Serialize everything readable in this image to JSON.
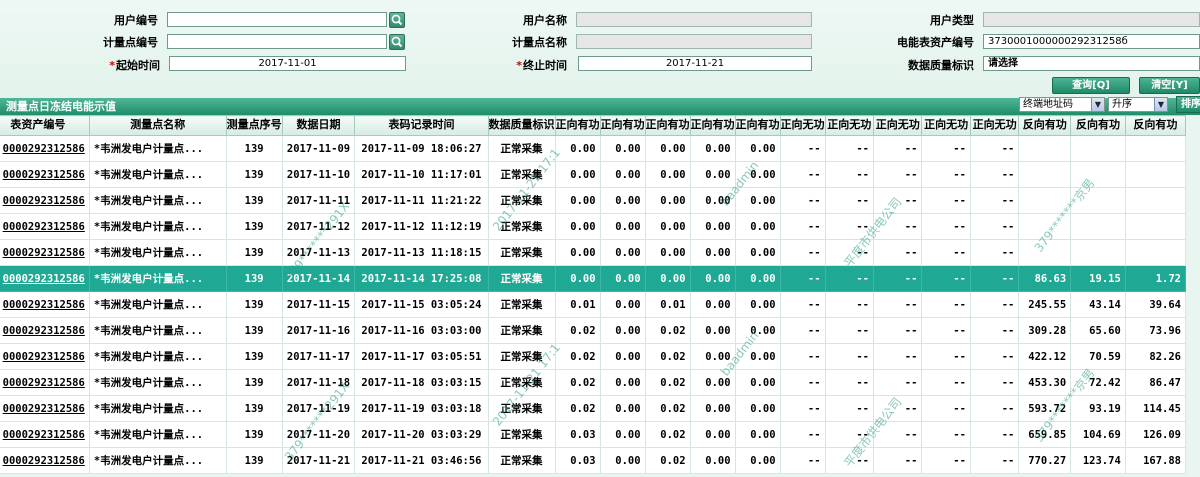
{
  "form": {
    "user_no_label": "用户编号",
    "user_no_value": "",
    "user_name_label": "用户名称",
    "user_name_value": "",
    "user_type_label": "用户类型",
    "user_type_value": "",
    "mp_no_label": "计量点编号",
    "mp_no_value": "",
    "mp_name_label": "计量点名称",
    "mp_name_value": "",
    "meter_asset_label": "电能表资产编号",
    "meter_asset_value": "373000100000029231258б",
    "start_time_label": "起始时间",
    "start_time_value": "2017-11-01",
    "end_time_label": "终止时间",
    "end_time_value": "2017-11-21",
    "quality_label": "数据质量标识",
    "quality_value": "请选择",
    "required_mark": "*",
    "query_button": "查询[Q]",
    "clear_button": "清空[Y]"
  },
  "panel": {
    "title": "测量点日冻结电能示值",
    "sort_field": "终端地址码",
    "sort_order": "升序",
    "sort_button": "排序"
  },
  "grid": {
    "headers": [
      "表资产编号",
      "测量点名称",
      "测量点序号",
      "数据日期",
      "表码记录时间",
      "数据质量标识",
      "正向有功",
      "正向有功",
      "正向有功",
      "正向有功",
      "正向有功",
      "正向无功",
      "正向无功",
      "正向无功",
      "正向无功",
      "正向无功",
      "反向有功",
      "反向有功",
      "反向有功"
    ],
    "rows": [
      [
        "0000292312586",
        "*韦洲发电户计量点...",
        "139",
        "2017-11-09",
        "2017-11-09 18:06:27",
        "正常采集",
        "0.00",
        "0.00",
        "0.00",
        "0.00",
        "0.00",
        "--",
        "--",
        "--",
        "--",
        "--",
        "",
        "",
        ""
      ],
      [
        "0000292312586",
        "*韦洲发电户计量点...",
        "139",
        "2017-11-10",
        "2017-11-10 11:17:01",
        "正常采集",
        "0.00",
        "0.00",
        "0.00",
        "0.00",
        "0.00",
        "--",
        "--",
        "--",
        "--",
        "--",
        "",
        "",
        ""
      ],
      [
        "0000292312586",
        "*韦洲发电户计量点...",
        "139",
        "2017-11-11",
        "2017-11-11 11:21:22",
        "正常采集",
        "0.00",
        "0.00",
        "0.00",
        "0.00",
        "0.00",
        "--",
        "--",
        "--",
        "--",
        "--",
        "",
        "",
        ""
      ],
      [
        "0000292312586",
        "*韦洲发电户计量点...",
        "139",
        "2017-11-12",
        "2017-11-12 11:12:19",
        "正常采集",
        "0.00",
        "0.00",
        "0.00",
        "0.00",
        "0.00",
        "--",
        "--",
        "--",
        "--",
        "--",
        "",
        "",
        ""
      ],
      [
        "0000292312586",
        "*韦洲发电户计量点...",
        "139",
        "2017-11-13",
        "2017-11-13 11:18:15",
        "正常采集",
        "0.00",
        "0.00",
        "0.00",
        "0.00",
        "0.00",
        "--",
        "--",
        "--",
        "--",
        "--",
        "",
        "",
        ""
      ],
      [
        "0000292312586",
        "*韦洲发电户计量点...",
        "139",
        "2017-11-14",
        "2017-11-14 17:25:08",
        "正常采集",
        "0.00",
        "0.00",
        "0.00",
        "0.00",
        "0.00",
        "--",
        "--",
        "--",
        "--",
        "--",
        "86.63",
        "19.15",
        "1.72"
      ],
      [
        "0000292312586",
        "*韦洲发电户计量点...",
        "139",
        "2017-11-15",
        "2017-11-15 03:05:24",
        "正常采集",
        "0.01",
        "0.00",
        "0.01",
        "0.00",
        "0.00",
        "--",
        "--",
        "--",
        "--",
        "--",
        "245.55",
        "43.14",
        "39.64"
      ],
      [
        "0000292312586",
        "*韦洲发电户计量点...",
        "139",
        "2017-11-16",
        "2017-11-16 03:03:00",
        "正常采集",
        "0.02",
        "0.00",
        "0.02",
        "0.00",
        "0.00",
        "--",
        "--",
        "--",
        "--",
        "--",
        "309.28",
        "65.60",
        "73.96"
      ],
      [
        "0000292312586",
        "*韦洲发电户计量点...",
        "139",
        "2017-11-17",
        "2017-11-17 03:05:51",
        "正常采集",
        "0.02",
        "0.00",
        "0.02",
        "0.00",
        "0.00",
        "--",
        "--",
        "--",
        "--",
        "--",
        "422.12",
        "70.59",
        "82.26"
      ],
      [
        "0000292312586",
        "*韦洲发电户计量点...",
        "139",
        "2017-11-18",
        "2017-11-18 03:03:15",
        "正常采集",
        "0.02",
        "0.00",
        "0.02",
        "0.00",
        "0.00",
        "--",
        "--",
        "--",
        "--",
        "--",
        "453.30",
        "72.42",
        "86.47"
      ],
      [
        "0000292312586",
        "*韦洲发电户计量点...",
        "139",
        "2017-11-19",
        "2017-11-19 03:03:18",
        "正常采集",
        "0.02",
        "0.00",
        "0.02",
        "0.00",
        "0.00",
        "--",
        "--",
        "--",
        "--",
        "--",
        "593.72",
        "93.19",
        "114.45"
      ],
      [
        "0000292312586",
        "*韦洲发电户计量点...",
        "139",
        "2017-11-20",
        "2017-11-20 03:03:29",
        "正常采集",
        "0.03",
        "0.00",
        "0.02",
        "0.00",
        "0.00",
        "--",
        "--",
        "--",
        "--",
        "--",
        "659.85",
        "104.69",
        "126.09"
      ],
      [
        "0000292312586",
        "*韦洲发电户计量点...",
        "139",
        "2017-11-21",
        "2017-11-21 03:46:56",
        "正常采集",
        "0.03",
        "0.00",
        "0.02",
        "0.00",
        "0.00",
        "--",
        "--",
        "--",
        "--",
        "--",
        "770.27",
        "123.74",
        "167.88"
      ]
    ],
    "selected_row": 5
  },
  "watermarks": [
    "379*******291X",
    "2017-11-21 17:1",
    "baadmin",
    "平度市供电公司",
    "379*******京男"
  ],
  "colors": {
    "accent": "#1fa894",
    "header_bar": "#1f8d6b",
    "background": "#e8f5f0",
    "required": "#d00000"
  }
}
